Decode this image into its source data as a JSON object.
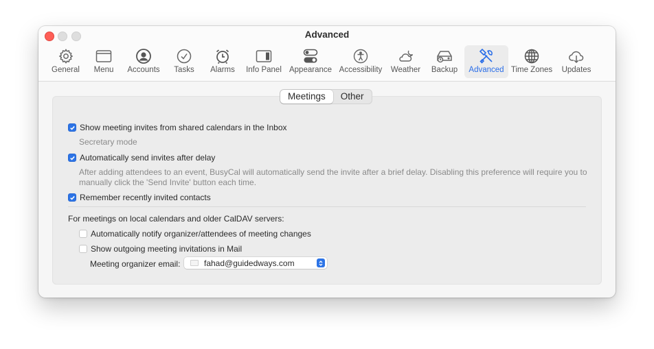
{
  "window": {
    "title": "Advanced"
  },
  "toolbar": {
    "items": [
      {
        "label": "General",
        "icon": "gear-icon"
      },
      {
        "label": "Menu",
        "icon": "window-icon"
      },
      {
        "label": "Accounts",
        "icon": "person-circle-icon"
      },
      {
        "label": "Tasks",
        "icon": "checkmark-circle-icon"
      },
      {
        "label": "Alarms",
        "icon": "alarm-clock-icon"
      },
      {
        "label": "Info Panel",
        "icon": "sidebar-right-icon"
      },
      {
        "label": "Appearance",
        "icon": "toggles-icon"
      },
      {
        "label": "Accessibility",
        "icon": "accessibility-icon"
      },
      {
        "label": "Weather",
        "icon": "cloud-moon-icon"
      },
      {
        "label": "Backup",
        "icon": "drive-clock-icon"
      },
      {
        "label": "Advanced",
        "icon": "wrench-screwdriver-icon",
        "active": true
      },
      {
        "label": "Time Zones",
        "icon": "globe-icon"
      },
      {
        "label": "Updates",
        "icon": "cloud-download-icon"
      }
    ],
    "accent_color": "#2a6ee8"
  },
  "tabs": {
    "items": [
      {
        "label": "Meetings",
        "active": true
      },
      {
        "label": "Other",
        "active": false
      }
    ]
  },
  "meetings": {
    "show_invites": {
      "label": "Show meeting invites from shared calendars in the Inbox",
      "checked": true
    },
    "secretary_mode": "Secretary mode",
    "auto_send": {
      "label": "Automatically send invites after delay",
      "checked": true
    },
    "auto_send_desc_line1": "After adding attendees to an event, BusyCal will automatically send the invite after a brief delay. Disabling this preference will require you to",
    "auto_send_desc_line2": "manually click the 'Send Invite' button each time.",
    "remember_contacts": {
      "label": "Remember recently invited contacts",
      "checked": true
    },
    "local_heading": "For meetings on local calendars and older CalDAV servers:",
    "notify_changes": {
      "label": "Automatically notify organizer/attendees of meeting changes",
      "checked": false
    },
    "show_outgoing": {
      "label": "Show outgoing meeting invitations in Mail",
      "checked": false
    },
    "organizer_email_label": "Meeting organizer email:",
    "organizer_email_value": "fahad@guidedways.com"
  }
}
